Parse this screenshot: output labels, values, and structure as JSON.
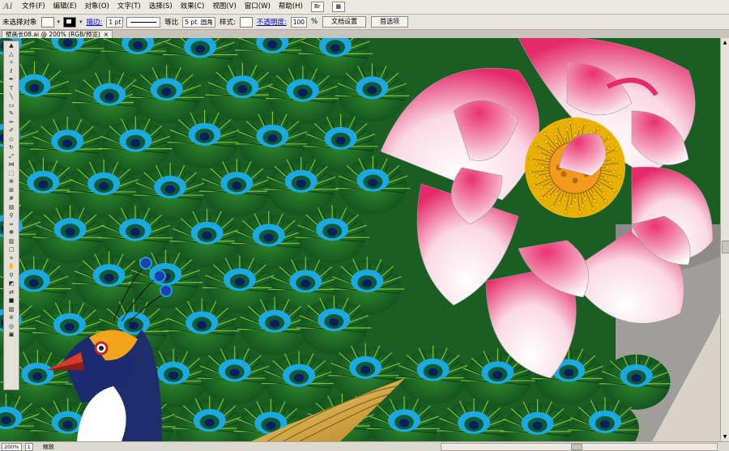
{
  "app": {
    "logo": "Ai"
  },
  "menu": [
    "文件(F)",
    "编辑(E)",
    "对象(O)",
    "文字(T)",
    "选择(S)",
    "效果(C)",
    "视图(V)",
    "窗口(W)",
    "帮助(H)"
  ],
  "control_bar": {
    "selection_label": "未选择对象",
    "stroke_link": "描边:",
    "stroke_weight": "1 pt",
    "profile_label": "等比",
    "brush_label": "5 pt. 圆角",
    "style_label": "样式:",
    "opacity_link": "不透明度:",
    "opacity_value": "100",
    "percent": "%",
    "document_setup_button": "文档设置",
    "preferences_button": "首选项"
  },
  "document_tab": {
    "title": "壁画长08.ai @ 200% (RGB/预览)",
    "close": "×"
  },
  "status_bar": {
    "zoom": "200%",
    "page": "1",
    "tool_label": "缩放"
  },
  "icons": [
    "app-logo",
    "bridge-icon",
    "arrange-icon",
    "close-icon",
    "chevron-down-icon"
  ],
  "colors": {
    "peacock_green": "#1e6b28",
    "eye_blue": "#1aa9e0",
    "lotus_pink": "#e8336f",
    "stamen_yellow": "#f2c500"
  }
}
